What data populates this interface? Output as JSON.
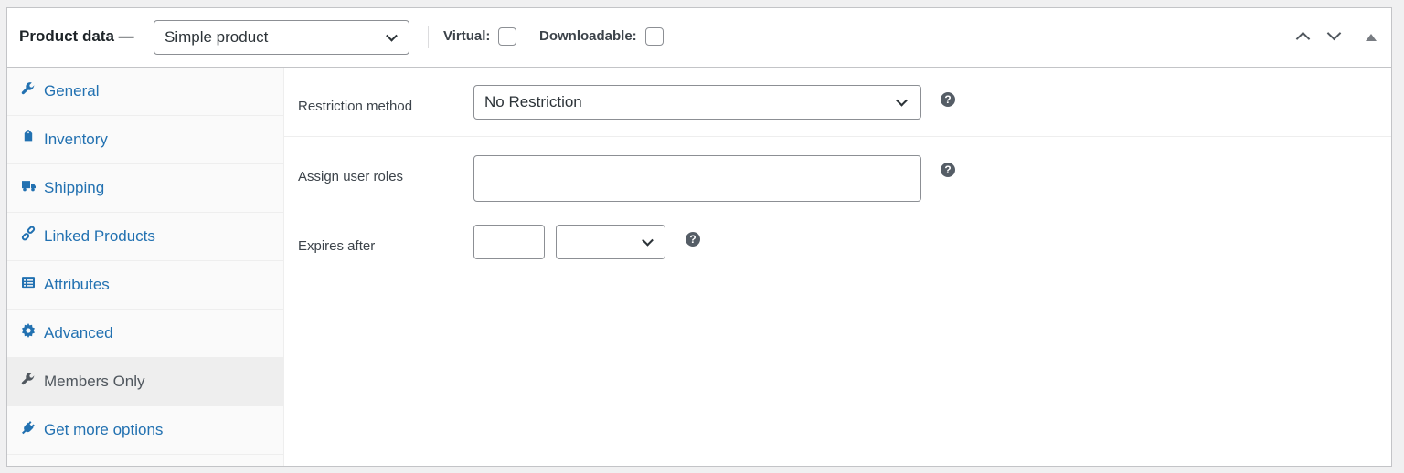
{
  "header": {
    "title": "Product data —",
    "product_type": "Simple product",
    "virtual_label": "Virtual:",
    "downloadable_label": "Downloadable:"
  },
  "sidebar": {
    "items": [
      {
        "label": "General",
        "icon": "wrench-icon"
      },
      {
        "label": "Inventory",
        "icon": "tag-icon"
      },
      {
        "label": "Shipping",
        "icon": "truck-icon"
      },
      {
        "label": "Linked Products",
        "icon": "link-icon"
      },
      {
        "label": "Attributes",
        "icon": "list-icon"
      },
      {
        "label": "Advanced",
        "icon": "gear-icon"
      },
      {
        "label": "Members Only",
        "icon": "wrench-icon"
      },
      {
        "label": "Get more options",
        "icon": "plug-icon"
      }
    ],
    "active": "Members Only"
  },
  "form": {
    "restriction_label": "Restriction method",
    "restriction_value": "No Restriction",
    "roles_label": "Assign user roles",
    "roles_value": "",
    "expires_label": "Expires after",
    "expires_number": "",
    "expires_unit": "",
    "help_glyph": "?"
  },
  "colors": {
    "link": "#2271b1",
    "active_tab_bg": "#eeeeee",
    "border": "#c3c4c7"
  }
}
